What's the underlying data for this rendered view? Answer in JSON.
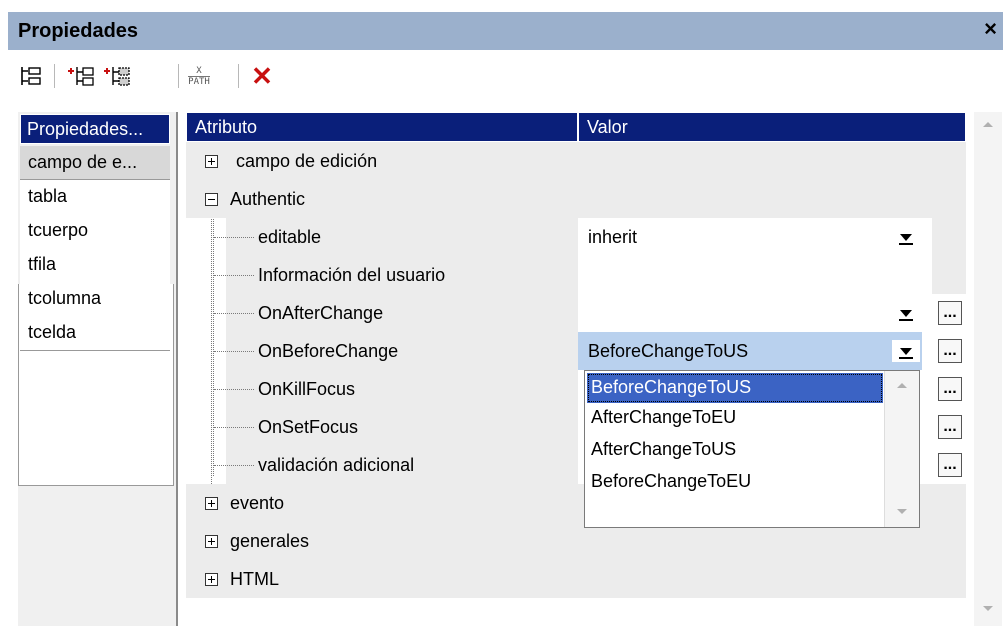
{
  "window": {
    "title": "Propiedades",
    "close_glyph": "×"
  },
  "toolbar": {
    "buttons": [
      {
        "name": "tree-view-icon"
      },
      {
        "name": "insert-property-group-icon"
      },
      {
        "name": "insert-property-icon"
      },
      {
        "name": "xpath-icon",
        "label_top": "X",
        "label_bottom": "PATH"
      },
      {
        "name": "delete-icon",
        "glyph": "✕",
        "color": "#c81010"
      }
    ]
  },
  "left_panel": {
    "header": "Propiedades...",
    "items": [
      "campo de e...",
      "tabla",
      "tcuerpo",
      "tfila",
      "tcolumna",
      "tcelda"
    ],
    "selected": "campo de e..."
  },
  "grid": {
    "headers": {
      "attribute": "Atributo",
      "value": "Valor"
    },
    "rows": [
      {
        "label": "campo de edición",
        "expander": "plus"
      },
      {
        "label": "Authentic",
        "expander": "minus"
      },
      {
        "label": "editable",
        "value": "inherit"
      },
      {
        "label": "Información del usuario"
      },
      {
        "label": "OnAfterChange"
      },
      {
        "label": "OnBeforeChange",
        "value": "BeforeChangeToUS"
      },
      {
        "label": "OnKillFocus"
      },
      {
        "label": "OnSetFocus"
      },
      {
        "label": "validación adicional"
      },
      {
        "label": "evento",
        "expander": "plus"
      },
      {
        "label": "generales",
        "expander": "plus"
      },
      {
        "label": "HTML",
        "expander": "plus"
      }
    ],
    "ellipsis": "..."
  },
  "dropdown": {
    "options": [
      "BeforeChangeToUS",
      "AfterChangeToEU",
      "AfterChangeToUS",
      "BeforeChangeToEU"
    ],
    "selected": "BeforeChangeToUS"
  },
  "colors": {
    "title_bar": "#9bb0cc",
    "header_bg": "#0a1f7a",
    "selection": "#3b63c4",
    "selected_row_value": "#b9d1ee"
  }
}
